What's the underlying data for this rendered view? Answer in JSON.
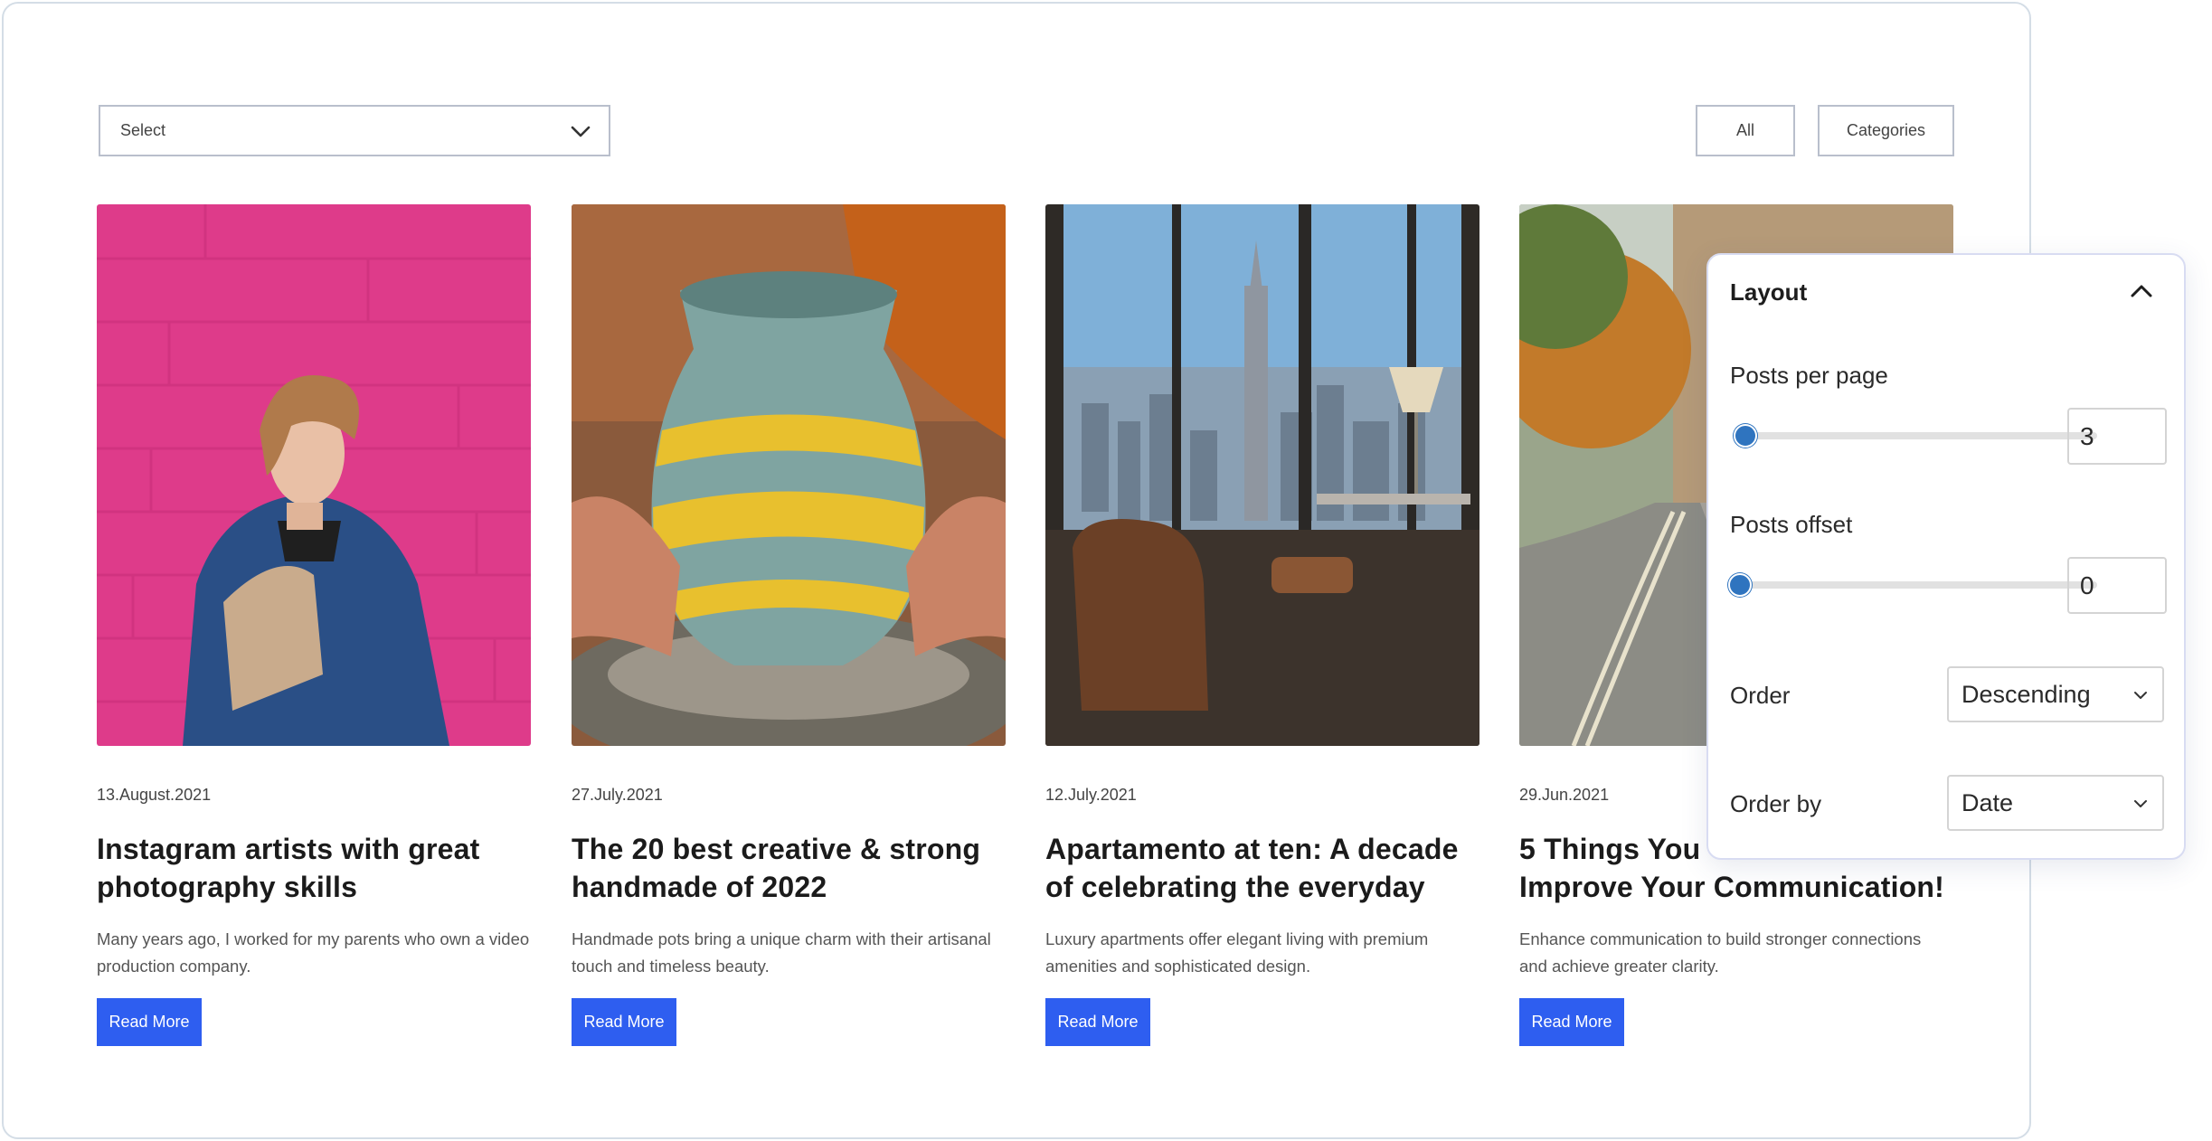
{
  "filters": {
    "select_label": "Select",
    "all_label": "All",
    "categories_label": "Categories"
  },
  "posts": [
    {
      "date": "13.August.2021",
      "title": "Instagram artists with great photography skills",
      "excerpt": "Many years ago, I worked for my parents who own a video production company.",
      "button": "Read More"
    },
    {
      "date": "27.July.2021",
      "title": "The 20 best creative & strong handmade of 2022",
      "excerpt": "Handmade pots bring a unique charm with their artisanal touch and timeless beauty.",
      "button": "Read More"
    },
    {
      "date": "12.July.2021",
      "title": "Apartamento at ten: A decade of celebrating the everyday",
      "excerpt": "Luxury apartments offer elegant living with premium amenities and sophisticated design.",
      "button": "Read More"
    },
    {
      "date": "29.Jun.2021",
      "title": "5 Things You Can Do to Improve Your Communication!",
      "excerpt": "Enhance communication to build stronger connections and achieve greater clarity.",
      "button": "Read More"
    }
  ],
  "layout_panel": {
    "title": "Layout",
    "posts_per_page_label": "Posts per page",
    "posts_per_page_value": "3",
    "posts_offset_label": "Posts offset",
    "posts_offset_value": "0",
    "order_label": "Order",
    "order_value": "Descending",
    "order_by_label": "Order by",
    "order_by_value": "Date"
  },
  "colors": {
    "accent": "#2e5ef0",
    "slider": "#2f74bf",
    "border": "#b9bfcc"
  }
}
